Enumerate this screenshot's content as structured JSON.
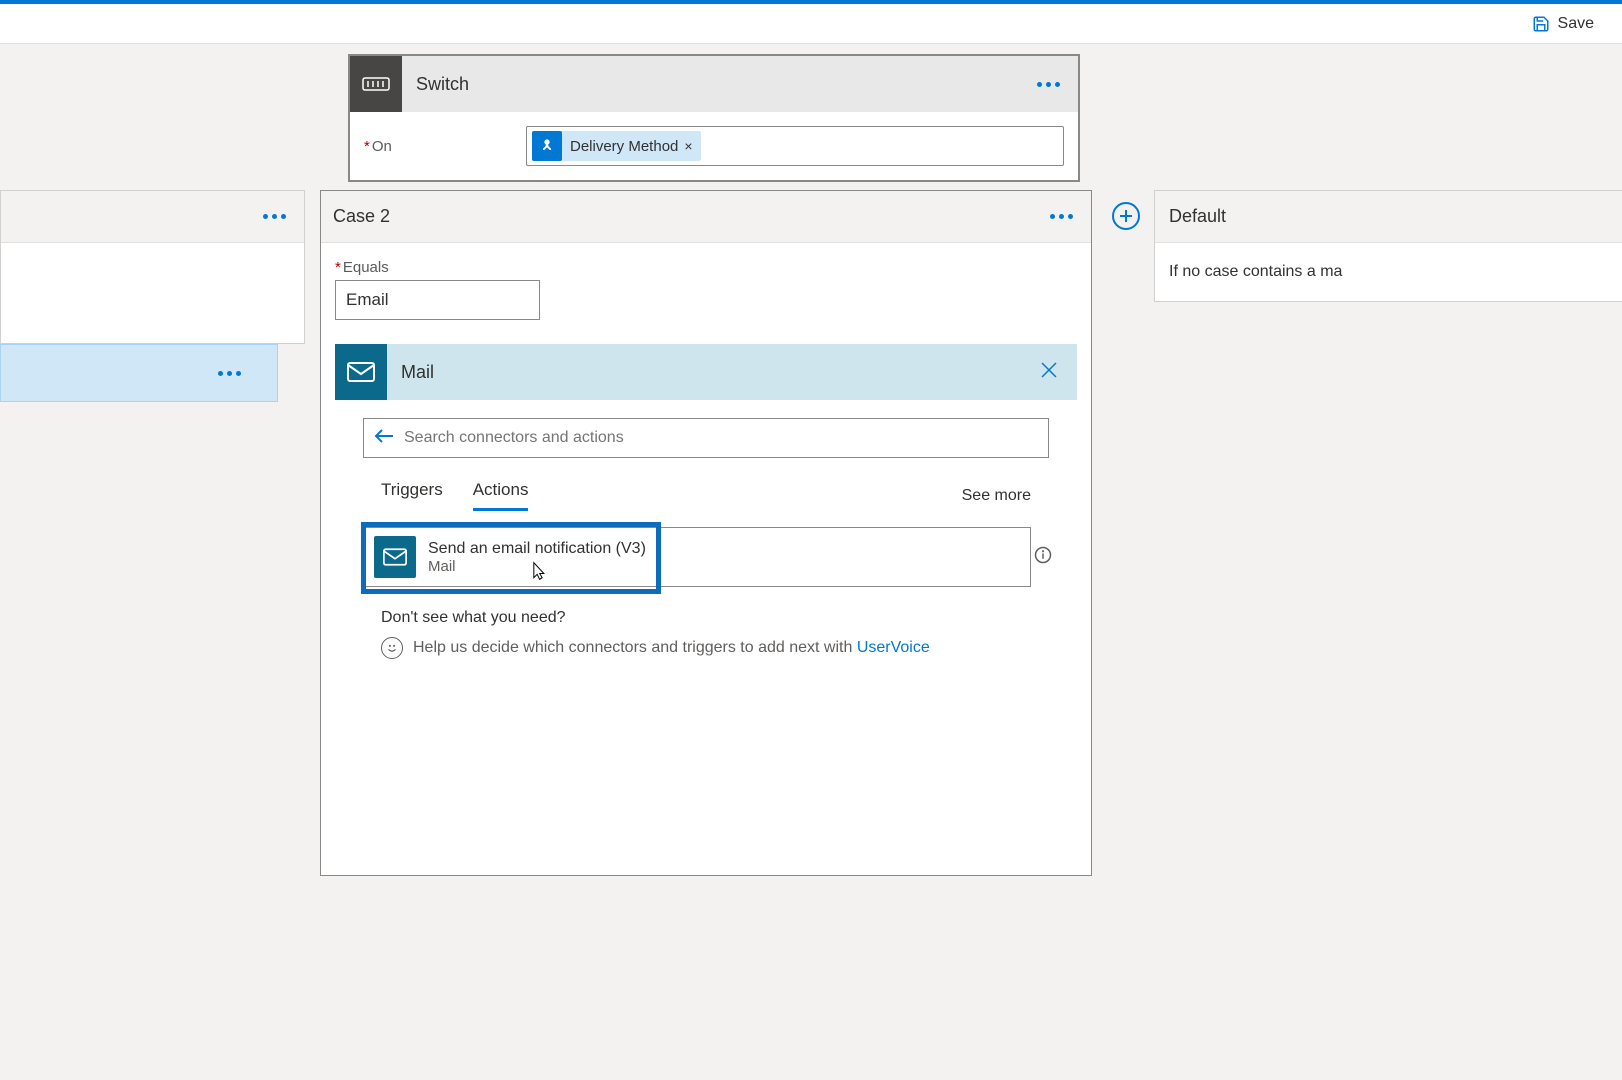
{
  "toolbar": {
    "save_label": "Save"
  },
  "switch": {
    "title": "Switch",
    "on_label": "On",
    "token": "Delivery Method"
  },
  "case2": {
    "title": "Case 2",
    "equals_label": "Equals",
    "equals_value": "Email"
  },
  "mail": {
    "title": "Mail",
    "search_placeholder": "Search connectors and actions",
    "tabs": {
      "triggers": "Triggers",
      "actions": "Actions"
    },
    "see_more": "See more",
    "action": {
      "title": "Send an email notification (V3)",
      "subtitle": "Mail"
    },
    "help": {
      "title": "Don't see what you need?",
      "text": "Help us decide which connectors and triggers to add next with ",
      "link": "UserVoice"
    }
  },
  "default_card": {
    "title": "Default",
    "body": "If no case contains a ma"
  }
}
